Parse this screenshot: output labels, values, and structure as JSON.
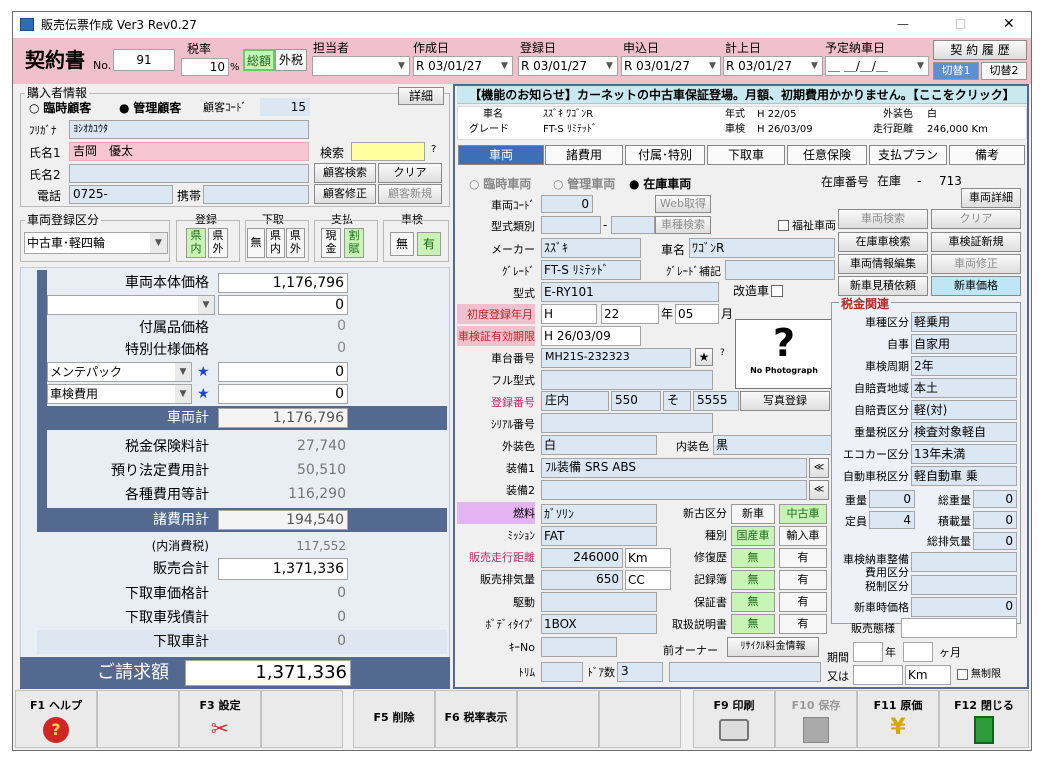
{
  "window": {
    "title": "販売伝票作成 Ver3 Rev0.27",
    "min": "—",
    "max": "□",
    "close": "✕"
  },
  "header": {
    "contract_label": "契約書",
    "no_label": "No.",
    "no_value": "91",
    "tax_rate_label": "税率",
    "tax_rate_value": "10",
    "pct": "%",
    "total_label": "総額",
    "external_label": "外税",
    "staff_label": "担当者",
    "staff_value": "",
    "created_label": "作成日",
    "created_value": "R 03/01/27",
    "registered_label": "登録日",
    "registered_value": "R 03/01/27",
    "applied_label": "申込日",
    "applied_value": "R 03/01/27",
    "booked_label": "計上日",
    "booked_value": "R 03/01/27",
    "delivery_label": "予定納車日",
    "delivery_value": "＿ ＿/＿/＿",
    "history_btn": "契 約 履 歴",
    "switch1": "切替1",
    "switch2": "切替2"
  },
  "buyer": {
    "section": "購入者情報",
    "detail_btn": "詳細",
    "temp_label": "臨時顧客",
    "managed_label": "管理顧客",
    "code_label": "顧客ｺｰﾄﾞ",
    "code_value": "15",
    "kana_label": "ﾌﾘｶﾞﾅ",
    "kana_value": "ﾖｼｵｶﾕｳﾀ",
    "name1_label": "氏名1",
    "name1_value": "吉岡　優太",
    "name2_label": "氏名2",
    "name2_value": "",
    "tel_label": "電話",
    "tel_value": "0725-",
    "mobile_label": "携帯",
    "mobile_value": "",
    "search_label": "検索",
    "search_value": "",
    "question": "?",
    "btn_search": "顧客検索",
    "btn_clear": "クリア",
    "btn_edit": "顧客修正",
    "btn_new": "顧客新規"
  },
  "regclass": {
    "label": "車両登録区分",
    "value": "中古車･軽四輪",
    "reg_label": "登録",
    "reg_in": "県内",
    "reg_out": "県外",
    "trade_label": "下取",
    "trade_none": "無",
    "trade_in": "県内",
    "trade_out": "県外",
    "pay_label": "支払",
    "pay_cash": "現金",
    "pay_install": "割賦",
    "inspect_label": "車検",
    "inspect_none": "無",
    "inspect_yes": "有"
  },
  "price": {
    "body_label": "車両本体価格",
    "body_value": "1,176,796",
    "blank_value": "0",
    "acc_label": "付属品価格",
    "acc_value": "0",
    "special_label": "特別仕様価格",
    "special_value": "0",
    "maint_label": "メンテパック",
    "maint_value": "0",
    "inspect_label": "車検費用",
    "inspect_value": "0",
    "star": "★",
    "vehicle_total_label": "車両計",
    "vehicle_total_value": "1,176,796",
    "tax_label": "税金保険料計",
    "tax_value": "27,740",
    "legal_label": "預り法定費用計",
    "legal_value": "50,510",
    "fees_label": "各種費用等計",
    "fees_value": "116,290",
    "misc_total_label": "諸費用計",
    "misc_total_value": "194,540",
    "consumption_label": "(内消費税)",
    "consumption_value": "117,552",
    "sales_total_label": "販売合計",
    "sales_total_value": "1,371,336",
    "trade_price_label": "下取車価格計",
    "trade_price_value": "0",
    "trade_balance_label": "下取車残債計",
    "trade_balance_value": "0",
    "trade_total_label": "下取車計",
    "trade_total_value": "0",
    "invoice_label": "ご請求額",
    "invoice_value": "1,371,336"
  },
  "notice": "【機能のお知らせ】カーネットの中古車保証登場。月額、初期費用かかりません。【ここをクリック】",
  "summary": {
    "name_label": "車名",
    "name_value": "ｽｽﾞｷ ﾜｺﾞﾝR",
    "grade_label": "グレード",
    "grade_value": "FT-S ﾘﾐﾃｯﾄﾞ",
    "year_label": "年式",
    "year_value": "H 22/05",
    "inspect_label": "車検",
    "inspect_value": "H 26/03/09",
    "color_label": "外装色",
    "color_value": "白",
    "mileage_label": "走行距離",
    "mileage_value": "246,000 Km"
  },
  "tabs": [
    "車両",
    "諸費用",
    "付属･特別",
    "下取車",
    "任意保険",
    "支払プラン",
    "備考"
  ],
  "vehicle": {
    "temp": "臨時車両",
    "managed": "管理車両",
    "stock": "在庫車両",
    "stock_no_label": "在庫番号",
    "stock_no_kind": "在庫",
    "stock_no_value": "713",
    "detail_btn": "車両詳細",
    "code_label": "車両ｺｰﾄﾞ",
    "code_value": "0",
    "web_btn": "Web取得",
    "model_label": "型式類別",
    "model_a": "",
    "dash": "-",
    "model_b": "",
    "car_search_btn": "車種検索",
    "welfare_label": "福祉車両",
    "btn_vsearch": "車両検索",
    "btn_clear": "クリア",
    "btn_stock_search": "在庫車検索",
    "btn_cert_new": "車検証新規",
    "btn_info_edit": "車両情報編集",
    "btn_vfix": "車両修正",
    "btn_estimate": "新車見積依頼",
    "btn_newprice": "新車価格",
    "maker_label": "メーカー",
    "maker_value": "ｽｽﾞｷ",
    "carname_label": "車名",
    "carname_value": "ﾜｺﾞﾝR",
    "grade_label": "ｸﾞﾚｰﾄﾞ",
    "grade_value": "FT-S ﾘﾐﾃｯﾄﾞ",
    "grade_sup_label": "ｸﾞﾚｰﾄﾞ補記",
    "grade_sup_value": "",
    "type_label": "型式",
    "type_value": "E-RY101",
    "modified_label": "改造車",
    "first_reg_label": "初度登録年月",
    "era": "H",
    "year": "22",
    "year_unit": "年",
    "month": "05",
    "month_unit": "月",
    "cert_exp_label": "車検証有効期限",
    "cert_exp_value": "H 26/03/09",
    "chassis_label": "車台番号",
    "chassis_value": "MH21S-232323",
    "photo_text": "No Photograph",
    "full_model_label": "フル型式",
    "full_model_value": "",
    "plate_label": "登録番号",
    "plate_area": "庄内",
    "plate_class": "550",
    "plate_kana": "そ",
    "plate_no": "5555",
    "photo_btn": "写真登録",
    "serial_label": "ｼﾘｱﾙ番号",
    "serial_value": "",
    "ext_label": "外装色",
    "ext_value": "白",
    "int_label": "内装色",
    "int_value": "黒",
    "equip1_label": "装備1",
    "equip1_value": "ﾌﾙ装備 SRS ABS",
    "equip2_label": "装備2",
    "equip2_value": "",
    "fuel_label": "燃料",
    "fuel_value": "ｶﾞｿﾘﾝ",
    "new_old_label": "新古区分",
    "new_label": "新車",
    "used_label": "中古車",
    "mission_label": "ﾐｯｼｮﾝ",
    "mission_value": "FAT",
    "kind_label": "種別",
    "kind_domestic": "国産車",
    "kind_import": "輸入車",
    "dist_label": "販売走行距離",
    "dist_value": "246000",
    "dist_unit": "Km",
    "repair_label": "修復歴",
    "none": "無",
    "yes": "有",
    "disp_label": "販売排気量",
    "disp_value": "650",
    "disp_unit": "CC",
    "record_label": "記録簿",
    "drive_label": "駆動",
    "drive_value": "",
    "warranty_label": "保証書",
    "body_label": "ﾎﾞﾃﾞｨﾀｲﾌﾟ",
    "body_value": "1BOX",
    "manual_label": "取扱説明書",
    "key_label": "ｷｰNo",
    "key_value": "",
    "prev_owner_label": "前オーナー",
    "recycle_btn": "ﾘｻｲｸﾙ料金情報",
    "trim_label": "ﾄﾘﾑ",
    "trim_value": "",
    "doors_label": "ﾄﾞｱ数",
    "doors_value": "3"
  },
  "tax": {
    "title": "税金関連",
    "veh_class_label": "車種区分",
    "veh_class_value": "軽乗用",
    "own_label": "自事",
    "own_value": "自家用",
    "cycle_label": "車検周期",
    "cycle_value": "2年",
    "region_label": "自賠責地域",
    "region_value": "本土",
    "cls_label": "自賠責区分",
    "cls_value": "軽(対)",
    "weight_tax_label": "重量税区分",
    "weight_tax_value": "検査対象軽自",
    "eco_label": "エコカー区分",
    "eco_value": "13年未満",
    "auto_tax_label": "自動車税区分",
    "auto_tax_value": "軽自動車 乗",
    "weight_label": "重量",
    "weight_value": "0",
    "gross_label": "総重量",
    "gross_value": "0",
    "capacity_label": "定員",
    "capacity_value": "4",
    "load_label": "積載量",
    "load_value": "0",
    "displacement_label": "総排気量",
    "displacement_value": "0",
    "delivery_cost_label": "車検納車整備費用区分",
    "tax_cls_label": "税制区分",
    "new_price_label": "新車時価格",
    "new_price_value": "0",
    "sales_form_label": "販売態様",
    "period_label": "期間",
    "year_unit": "年",
    "month_unit": "ヶ月",
    "or_label": "又は",
    "km_unit": "Km",
    "unlimited_label": "無制限"
  },
  "fkeys": {
    "f1": "F1 ヘルプ",
    "f3": "F3 設定",
    "f5": "F5 削除",
    "f6": "F6 税率表示",
    "f9": "F9 印刷",
    "f10": "F10 保存",
    "f11": "F11 原価",
    "f12": "F12 閉じる"
  }
}
